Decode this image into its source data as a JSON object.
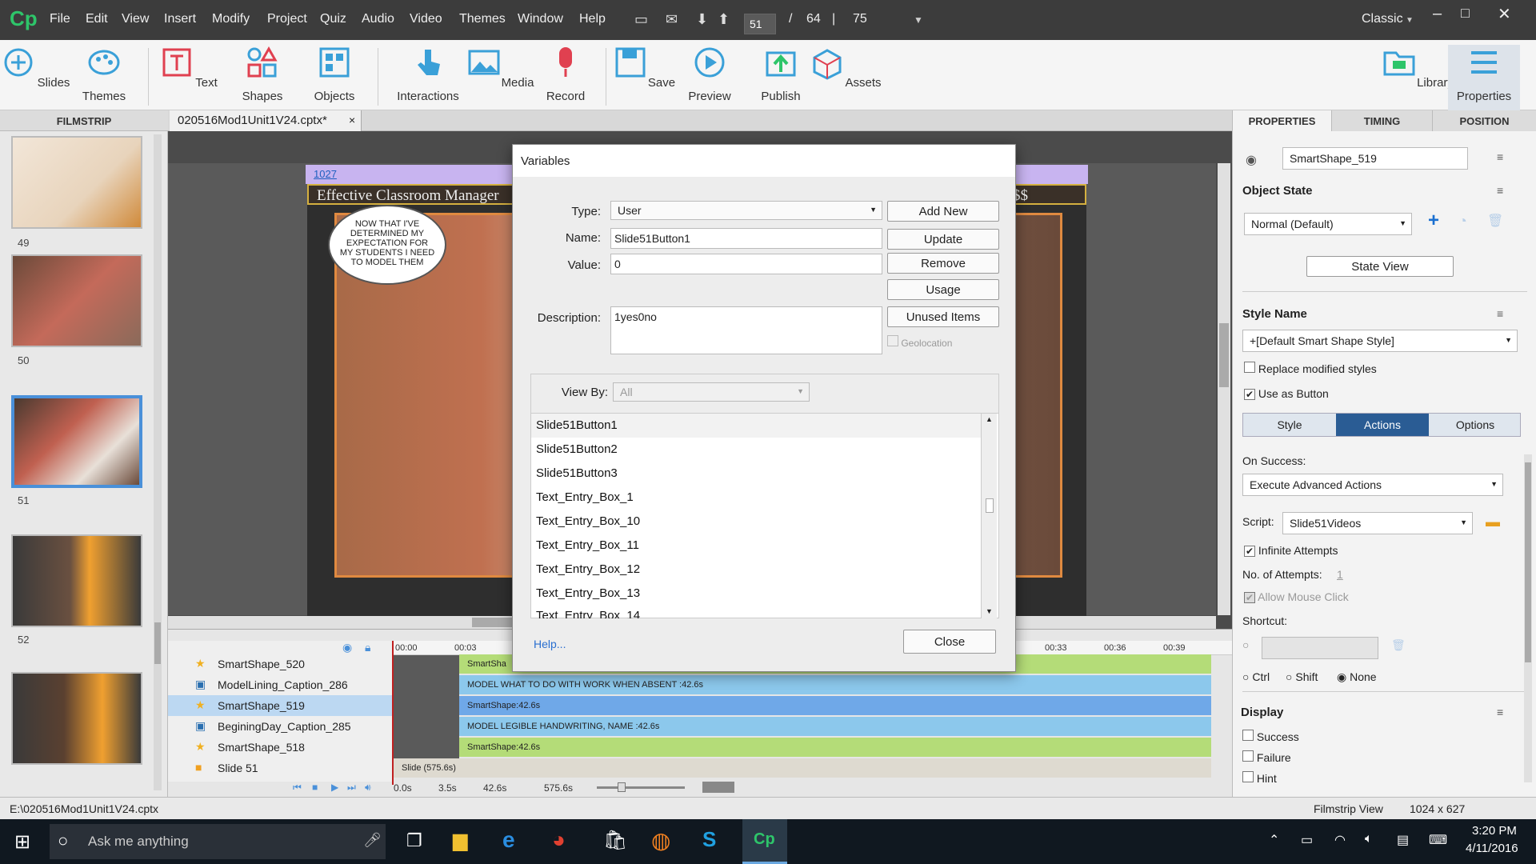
{
  "menubar": {
    "items": [
      "File",
      "Edit",
      "View",
      "Insert",
      "Modify",
      "Project",
      "Quiz",
      "Audio",
      "Video",
      "Themes",
      "Window",
      "Help"
    ],
    "current_slide": "51",
    "separator": "/",
    "total_slides": "64",
    "slash": "|",
    "zoom": "75",
    "workspace": "Classic"
  },
  "toolbar": {
    "slides": "Slides",
    "themes": "Themes",
    "text": "Text",
    "shapes": "Shapes",
    "objects": "Objects",
    "interactions": "Interactions",
    "media": "Media",
    "record": "Record",
    "save": "Save",
    "preview": "Preview",
    "publish": "Publish",
    "assets": "Assets",
    "library": "Library",
    "properties": "Properties"
  },
  "filmstrip": {
    "title": "FILMSTRIP",
    "slides": [
      "49",
      "50",
      "51",
      "52"
    ]
  },
  "document_tab": {
    "name": "020516Mod1Unit1V24.cptx*",
    "close": "×"
  },
  "stage": {
    "ruler_label": "1027",
    "slide_title": "Effective Classroom Manager",
    "slide_title_tail": "$$",
    "bubble_text": "NOW THAT I'VE DETERMINED MY EXPECTATION FOR MY STUDENTS I NEED TO MODEL THEM"
  },
  "timeline": {
    "ticks": [
      "00:00",
      "00:03",
      "00:33",
      "00:36",
      "00:39"
    ],
    "rows": [
      {
        "name": "SmartShape_520",
        "bar": "SmartSha"
      },
      {
        "name": "ModelLining_Caption_286",
        "bar": "MODEL WHAT TO DO WITH WORK WHEN ABSENT :42.6s"
      },
      {
        "name": "SmartShape_519",
        "bar": "SmartShape:42.6s"
      },
      {
        "name": "BeginingDay_Caption_285",
        "bar": "MODEL LEGIBLE HANDWRITING, NAME  :42.6s"
      },
      {
        "name": "SmartShape_518",
        "bar": "SmartShape:42.6s"
      },
      {
        "name": "Slide 51",
        "bar": "Slide (575.6s)"
      }
    ],
    "times": [
      "0.0s",
      "3.5s",
      "42.6s",
      "575.6s"
    ]
  },
  "dialog": {
    "title": "Variables",
    "type_label": "Type:",
    "type_value": "User",
    "name_label": "Name:",
    "name_value": "Slide51Button1",
    "value_label": "Value:",
    "value_value": "0",
    "desc_label": "Description:",
    "desc_value": "1yes0no",
    "btn_add": "Add New",
    "btn_update": "Update",
    "btn_remove": "Remove",
    "btn_usage": "Usage",
    "btn_unused": "Unused Items",
    "geolocation": "Geolocation",
    "viewby_label": "View By:",
    "viewby_value": "All",
    "list": [
      "Slide51Button1",
      "Slide51Button2",
      "Slide51Button3",
      "Text_Entry_Box_1",
      "Text_Entry_Box_10",
      "Text_Entry_Box_11",
      "Text_Entry_Box_12",
      "Text_Entry_Box_13",
      "Text_Entry_Box_14"
    ],
    "help": "Help...",
    "close": "Close"
  },
  "props": {
    "tabs": [
      "PROPERTIES",
      "TIMING",
      "POSITION"
    ],
    "object_name": "SmartShape_519",
    "object_state": "Object State",
    "state_value": "Normal (Default)",
    "state_view": "State View",
    "style_name": "Style Name",
    "style_value": "+[Default Smart Shape Style]",
    "replace_styles": "Replace modified styles",
    "use_as_button": "Use as Button",
    "subtabs": [
      "Style",
      "Actions",
      "Options"
    ],
    "on_success": "On Success:",
    "on_success_value": "Execute Advanced Actions",
    "script_label": "Script:",
    "script_value": "Slide51Videos",
    "infinite": "Infinite Attempts",
    "attempts_label": "No. of Attempts:",
    "attempts_value": "1",
    "allow_click": "Allow Mouse Click",
    "shortcut": "Shortcut:",
    "ctrl": "Ctrl",
    "shift": "Shift",
    "none": "None",
    "display": "Display",
    "success": "Success",
    "failure": "Failure",
    "hint": "Hint"
  },
  "status": {
    "path": "E:\\020516Mod1Unit1V24.cptx",
    "view": "Filmstrip View",
    "size": "1024 x 627"
  },
  "taskbar": {
    "search": "Ask me anything",
    "time": "3:20 PM",
    "date": "4/11/2016"
  },
  "colors": {
    "accent": "#4a90d9",
    "timeline_green": "#b4dc78",
    "timeline_blue": "#8cc8ec"
  }
}
